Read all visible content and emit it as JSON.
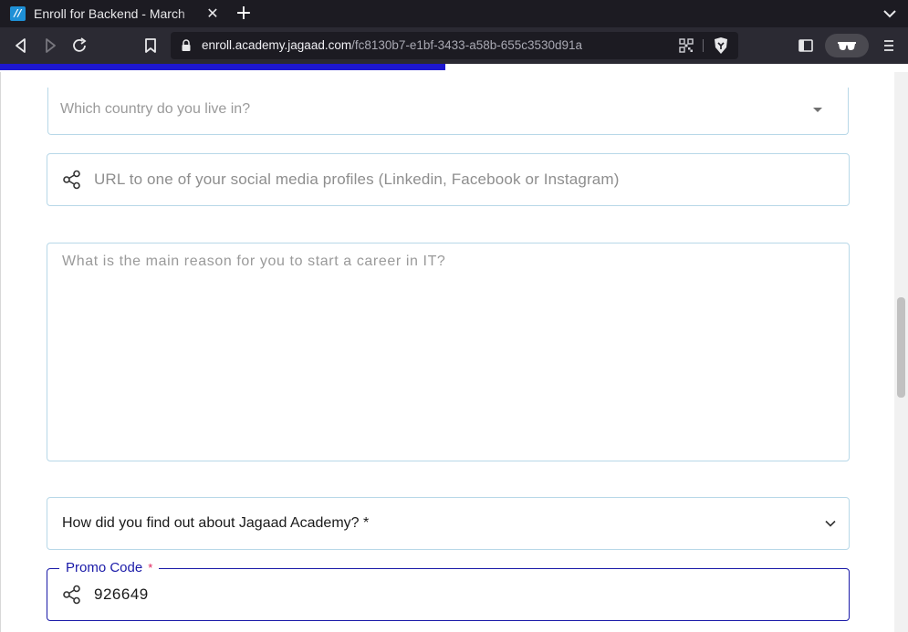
{
  "browser": {
    "tab": {
      "title": "Enroll for Backend - March",
      "favicon_glyph": "//",
      "close_label": "✕"
    },
    "new_tab_label": "+",
    "url": {
      "host": "enroll.academy.jagaad.com",
      "path": "/fc8130b7-e1bf-3433-a58b-655c3530d91a"
    },
    "progress": 0.49,
    "icons": [
      "back-icon",
      "forward-icon",
      "reload-icon",
      "bookmark-icon",
      "lock-icon",
      "qr-code-icon",
      "brave-shield-icon",
      "sidebar-icon",
      "private-glasses-icon",
      "menu-icon",
      "tab-list-chevron-icon"
    ]
  },
  "form": {
    "country_placeholder": "Which country do you live in?",
    "social_placeholder": "URL to one of your social media profiles (Linkedin, Facebook or Instagram)",
    "reason_placeholder": "What is the main reason for you to start a career in IT?",
    "source_label": "How did you find out about Jagaad Academy? *",
    "promo": {
      "label": "Promo Code",
      "required_marker": "*",
      "value": "926649"
    }
  },
  "colors": {
    "chrome_dark": "#1c1b22",
    "toolbar": "#2b2a33",
    "progress": "#1d17d0",
    "field_border": "#b8d8e8",
    "focus_border": "#1a1aa8",
    "required": "#e0245e"
  }
}
